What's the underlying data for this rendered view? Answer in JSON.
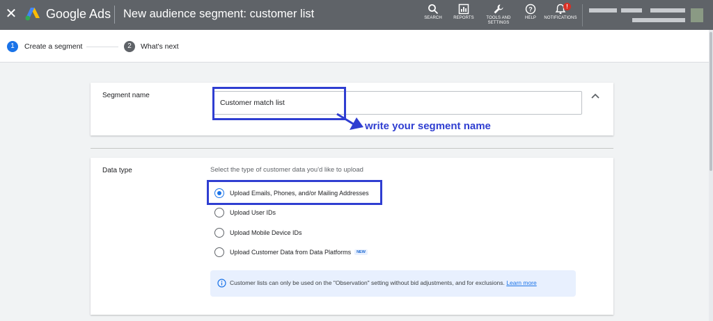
{
  "header": {
    "brand": "Google Ads",
    "page_title": "New audience segment: customer list",
    "actions": [
      {
        "label": "SEARCH",
        "icon": "search-icon"
      },
      {
        "label": "REPORTS",
        "icon": "reports-icon"
      },
      {
        "label_line1": "TOOLS AND",
        "label_line2": "SETTINGS",
        "icon": "wrench-icon"
      },
      {
        "label": "HELP",
        "icon": "help-icon"
      },
      {
        "label": "NOTIFICATIONS",
        "icon": "bell-icon",
        "badge": "!"
      }
    ]
  },
  "stepper": {
    "steps": [
      {
        "number": "1",
        "label": "Create a segment",
        "state": "active"
      },
      {
        "number": "2",
        "label": "What's next",
        "state": "inactive"
      }
    ]
  },
  "segment": {
    "label": "Segment name",
    "value": "Customer match list"
  },
  "data_type": {
    "label": "Data type",
    "hint": "Select the type of customer data you'd like to upload",
    "options": [
      {
        "label": "Upload Emails, Phones, and/or Mailing Addresses",
        "selected": true
      },
      {
        "label": "Upload User IDs",
        "selected": false
      },
      {
        "label": "Upload Mobile Device IDs",
        "selected": false
      },
      {
        "label": "Upload Customer Data from Data Platforms",
        "badge": "NEW",
        "selected": false
      }
    ],
    "info": {
      "text": "Customer lists can only be used on the \"Observation\" setting without bid adjustments, and for exclusions.",
      "link": "Learn more"
    }
  },
  "annotation": {
    "text": "write your segment name"
  },
  "colors": {
    "header_bg": "#5f6368",
    "accent": "#1a73e8",
    "annotation": "#2f3ed1"
  }
}
